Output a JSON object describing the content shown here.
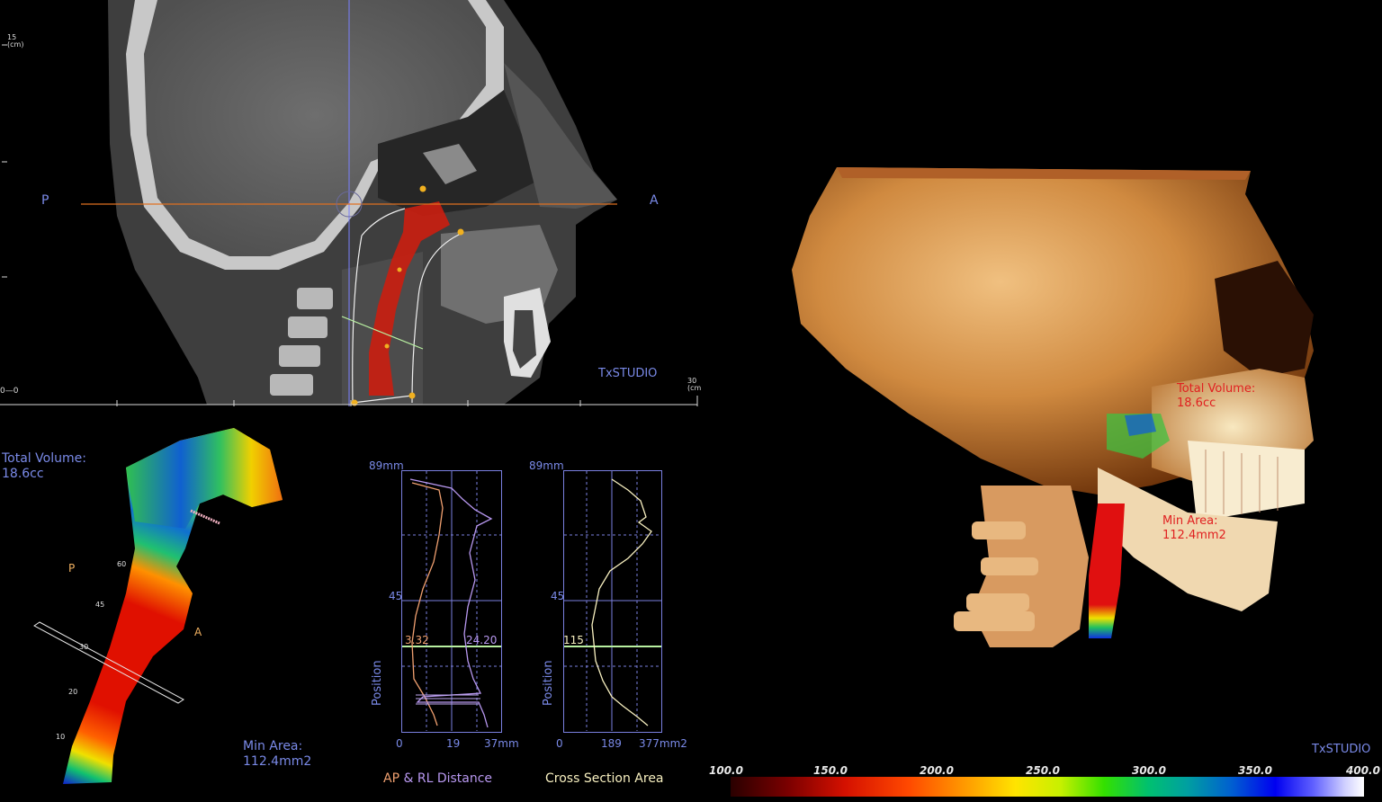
{
  "ct_view": {
    "label_posterior": "P",
    "label_anterior": "A",
    "watermark": "TxSTUDIO",
    "ruler_top": "15",
    "ruler_top_unit": "(cm)",
    "ruler_origin": "0—0",
    "ruler_right": "30",
    "ruler_right_unit": "(cm)"
  },
  "airway_3d": {
    "total_volume_label": "Total Volume:",
    "total_volume_value": "18.6cc",
    "min_area_label": "Min Area:",
    "min_area_value": "112.4mm2",
    "marker_p": "P",
    "marker_a": "A",
    "depth_ticks": [
      "60",
      "45",
      "30",
      "20",
      "10"
    ]
  },
  "graph_distance": {
    "top_label": "89mm",
    "mid_label": "45",
    "y_axis_label": "Position",
    "x_ticks": [
      "0",
      "19",
      "37mm"
    ],
    "ap_value": "3.32",
    "rl_value": "24.20",
    "title_ap": "AP",
    "title_rest": " & RL Distance"
  },
  "graph_area": {
    "top_label": "89mm",
    "mid_label": "45",
    "y_axis_label": "Position",
    "x_ticks": [
      "0",
      "189",
      "377mm2"
    ],
    "value": "115",
    "title": "Cross Section Area"
  },
  "skull_view": {
    "total_volume_label": "Total Volume:",
    "total_volume_value": "18.6cc",
    "min_area_label": "Min Area:",
    "min_area_value": "112.4mm2",
    "watermark": "TxSTUDIO"
  },
  "color_legend": {
    "ticks": [
      "100.0",
      "150.0",
      "200.0",
      "250.0",
      "300.0",
      "350.0",
      "400.0"
    ]
  },
  "colors": {
    "accent_blue": "#7a8ae8",
    "airway_red": "#c81e10",
    "ap_line": "#f0a070",
    "rl_line": "#b898f0",
    "area_line": "#f8f0c0",
    "marker_green": "#b8f0a0"
  }
}
